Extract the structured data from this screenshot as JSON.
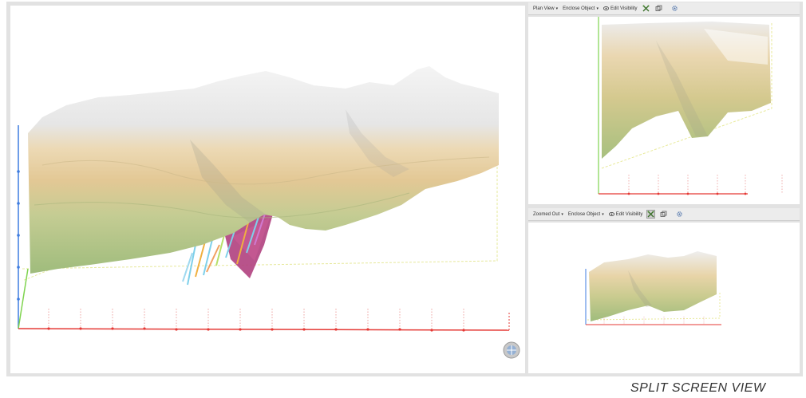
{
  "top_toolbar": {
    "view_label": "Plan View",
    "enclose_label": "Enclose Object",
    "visibility_label": "Edit Visibility"
  },
  "bottom_toolbar": {
    "view_label": "Zoomed Out",
    "enclose_label": "Enclose Object",
    "visibility_label": "Edit Visibility"
  },
  "caption": "SPLIT SCREEN VIEW",
  "colors": {
    "frame": "#e2e2e2",
    "axis_x": "#e53935",
    "axis_y": "#3f7de0",
    "axis_z": "#7fd44f",
    "box_outline": "#e8ea9a",
    "terrain_top": "#eeeeee",
    "terrain_mid": "#e7cfa0",
    "terrain_low": "#a9c281",
    "ore_body": "#b0407e",
    "drillhole": "#7fd0ea"
  },
  "icons": {
    "caret": "▾",
    "eye": "eye-icon",
    "select_tool": "crossed-tools-icon",
    "enclose_tool": "enclose-cube-icon",
    "settings_tool": "gear-icon",
    "navigator": "navigation-globe-icon"
  }
}
